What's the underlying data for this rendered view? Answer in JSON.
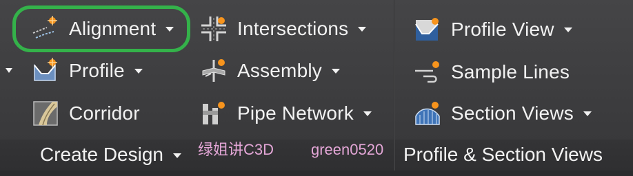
{
  "panels": [
    {
      "title": "Create Design",
      "tools": [
        {
          "label": "Alignment",
          "icon": "alignment-icon",
          "dropdown": true
        },
        {
          "label": "Profile",
          "icon": "profile-icon",
          "dropdown": true
        },
        {
          "label": "Corridor",
          "icon": "corridor-icon",
          "dropdown": false
        },
        {
          "label": "Intersections",
          "icon": "intersections-icon",
          "dropdown": true
        },
        {
          "label": "Assembly",
          "icon": "assembly-icon",
          "dropdown": true
        },
        {
          "label": "Pipe Network",
          "icon": "pipe-network-icon",
          "dropdown": true
        }
      ]
    },
    {
      "title": "Profile & Section Views",
      "tools": [
        {
          "label": "Profile View",
          "icon": "profile-view-icon",
          "dropdown": true
        },
        {
          "label": "Sample Lines",
          "icon": "sample-lines-icon",
          "dropdown": false
        },
        {
          "label": "Section Views",
          "icon": "section-views-icon",
          "dropdown": true
        }
      ]
    }
  ],
  "watermarks": [
    "绿姐讲C3D",
    "green0520"
  ],
  "colors": {
    "ribbon_bg": "#3a3a3c",
    "text": "#f2f2f2",
    "highlight_ring": "#34b24a",
    "icon_accent": "#f7941d",
    "watermark": "#e3a6d6"
  }
}
